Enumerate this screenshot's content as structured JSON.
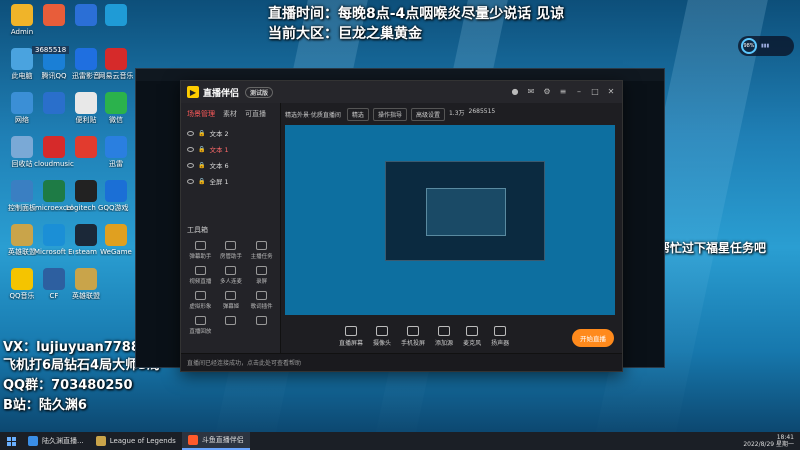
{
  "stream_overlay": {
    "schedule": "直播时间：每晚8点-4点咽喉炎尽量少说话 见谅",
    "region": "当前大区：巨龙之巢黄金",
    "side_note": "帮忙过下福星任务吧",
    "vx": "VX：lujiuyuan7788",
    "achievement": "飞机打6局钻石4局大师3局",
    "qq_group": "QQ群：703480250",
    "bilibili": "B站：陆久渊6"
  },
  "desktop_icons": [
    {
      "label": "Admin",
      "color": "#f0b429"
    },
    {
      "label": "",
      "color": "#e85d3a"
    },
    {
      "label": "",
      "color": "#2b6fd6"
    },
    {
      "label": "",
      "color": "#1f9bd6"
    },
    {
      "label": "此电脑",
      "color": "#4aa3df"
    },
    {
      "label": "腾讯QQ",
      "color": "#1a7fd6"
    },
    {
      "label": "迅雷影音",
      "color": "#1f6fe0"
    },
    {
      "label": "网易云音乐",
      "color": "#d62a2a"
    },
    {
      "label": "网络",
      "color": "#3b8fd6"
    },
    {
      "label": "",
      "color": "#2a6fcb"
    },
    {
      "label": "便利贴",
      "color": "#e8e8e8"
    },
    {
      "label": "微信",
      "color": "#2bb24c"
    },
    {
      "label": "回收站",
      "color": "#7aa9d6"
    },
    {
      "label": "cloudmusic",
      "color": "#d62a2a"
    },
    {
      "label": "",
      "color": "#e23b2e"
    },
    {
      "label": "迅雷",
      "color": "#2a7fe0"
    },
    {
      "label": "控制面板",
      "color": "#3a7fc2"
    },
    {
      "label": "microexcel",
      "color": "#1e7b45"
    },
    {
      "label": "Logitech G HUB",
      "color": "#222"
    },
    {
      "label": "QQ游戏",
      "color": "#1b6fd6"
    },
    {
      "label": "英雄联盟",
      "color": "#c9a44a"
    },
    {
      "label": "Microsoft Edge",
      "color": "#1b8fd6"
    },
    {
      "label": "steam",
      "color": "#1b2838"
    },
    {
      "label": "WeGame",
      "color": "#e0a020"
    },
    {
      "label": "QQ音乐",
      "color": "#f5c400"
    },
    {
      "label": "CF",
      "color": "#2d5fa0"
    },
    {
      "label": "英雄联盟",
      "color": "#c9a44a"
    }
  ],
  "badge_number": "3685518",
  "app": {
    "name": "直播伴侣",
    "badge": "测试版",
    "scene_tabs": [
      "场景管理",
      "素材",
      "可直播"
    ],
    "sources": [
      "文本 2",
      "文本 1",
      "文本 6",
      "全屏 1"
    ],
    "tools_title": "工具箱",
    "tools": [
      "弹幕助手",
      "房管助手",
      "主播任务",
      "视频直播",
      "多人连麦",
      "录屏",
      "虚拟形象",
      "弹幕姬",
      "歌词插件",
      "直播回放",
      "",
      ""
    ],
    "preview_title": "精选外景·优质直播间",
    "chips": [
      "精选",
      "操作指导",
      "高级设置"
    ],
    "stats": [
      "1.3万",
      "2685515"
    ],
    "bottom_tools": [
      "直播屏幕",
      "摄像头",
      "手机投屏",
      "添加源",
      "麦克风",
      "扬声器"
    ],
    "go_live": "开始直播",
    "status_text": "直播间已经连接成功，点击此处可查看帮助"
  },
  "taskbar": {
    "tasks": [
      "陆久渊直播...",
      "League of Legends",
      "斗鱼直播伴侣"
    ],
    "time": "18:41",
    "date": "2022/8/29 星期一"
  },
  "perf_badge": "98%"
}
